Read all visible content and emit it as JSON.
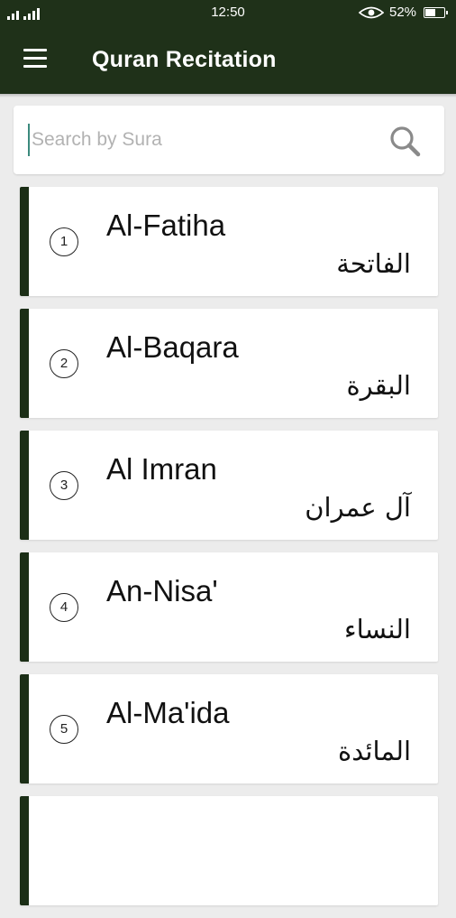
{
  "status": {
    "time": "12:50",
    "battery": "52%"
  },
  "app_bar": {
    "title": "Quran Recitation",
    "menu_icon": "hamburger-menu-icon"
  },
  "search": {
    "placeholder": "Search by Sura",
    "value": "",
    "icon": "search-icon"
  },
  "suras": [
    {
      "number": "1",
      "name": "Al-Fatiha",
      "arabic": "الفاتحة"
    },
    {
      "number": "2",
      "name": "Al-Baqara",
      "arabic": "البقرة"
    },
    {
      "number": "3",
      "name": "Al Imran",
      "arabic": "آل عمران"
    },
    {
      "number": "4",
      "name": "An-Nisa'",
      "arabic": "النساء"
    },
    {
      "number": "5",
      "name": "Al-Ma'ida",
      "arabic": "المائدة"
    },
    {
      "number": "",
      "name": "",
      "arabic": ""
    }
  ],
  "colors": {
    "primary": "#1f3119",
    "accent_bar": "#1b2e16",
    "background": "#ececec"
  }
}
